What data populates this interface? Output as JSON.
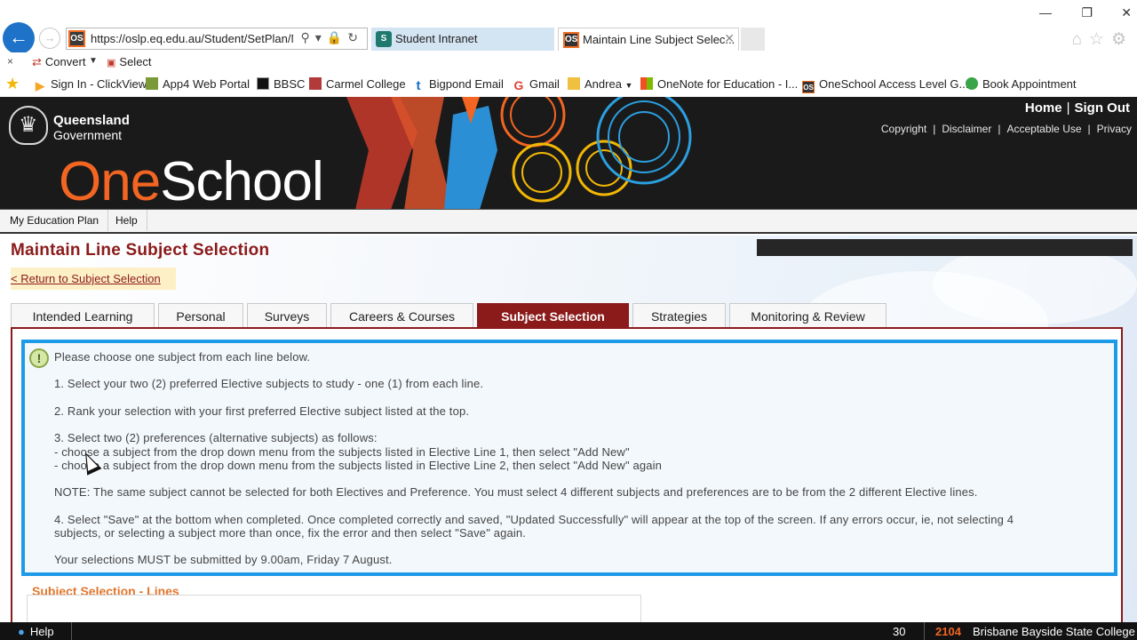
{
  "browser": {
    "address": "https://oslp.eq.edu.au/Student/SetPlan/M",
    "tabs": [
      {
        "label": "Student Intranet"
      },
      {
        "label": "Maintain Line Subject Selec..."
      }
    ],
    "favicon_text": "OS"
  },
  "command_bar": {
    "close": "×",
    "convert": "Convert",
    "select": "Select"
  },
  "favorites": [
    {
      "label": "Sign In - ClickView",
      "icon": "arrow-icon",
      "color": "#f5a623"
    },
    {
      "label": "App4 Web Portal",
      "icon": "app4-icon",
      "color": "#7a9a3a"
    },
    {
      "label": "BBSC",
      "icon": "bbsc-icon",
      "color": "#111111"
    },
    {
      "label": "Carmel College",
      "icon": "carmel-icon",
      "color": "#b33a3a"
    },
    {
      "label": "Bigpond Email",
      "icon": "bigpond-icon",
      "color": "#1a6fc9"
    },
    {
      "label": "Gmail",
      "icon": "google-icon",
      "color": "#db4437"
    },
    {
      "label": "Andrea",
      "icon": "folder-icon",
      "color": "#f0c040"
    },
    {
      "label": "OneNote for Education - I...",
      "icon": "microsoft-icon",
      "color": "#f25022"
    },
    {
      "label": "OneSchool Access Level G...",
      "icon": "oneschool-icon",
      "color": "#333333"
    },
    {
      "label": "Book Appointment",
      "icon": "gear-icon",
      "color": "#3aa548"
    }
  ],
  "header": {
    "gov_line1": "Queensland",
    "gov_line2": "Government",
    "brand_one": "One",
    "brand_school": "School",
    "home": "Home",
    "sign_out": "Sign Out",
    "links": [
      "Copyright",
      "Disclaimer",
      "Acceptable Use",
      "Privacy"
    ]
  },
  "menu": [
    "My Education Plan",
    "Help"
  ],
  "page": {
    "title": "Maintain Line Subject Selection",
    "return_link": "< Return to Subject Selection",
    "tabs": [
      {
        "label": "Intended Learning",
        "active": false
      },
      {
        "label": "Personal",
        "active": false
      },
      {
        "label": "Surveys",
        "active": false
      },
      {
        "label": "Careers & Courses",
        "active": false
      },
      {
        "label": "Subject Selection",
        "active": true
      },
      {
        "label": "Strategies",
        "active": false
      },
      {
        "label": "Monitoring & Review",
        "active": false
      }
    ],
    "note": {
      "icon": "!",
      "lines": [
        "Please choose one subject from each line below.",
        "1. Select your two (2) preferred Elective subjects to study - one (1) from each line.",
        "2. Rank your selection with your first preferred Elective subject listed at the top.",
        "3. Select two (2) preferences (alternative subjects) as follows:",
        "- choose a subject from the drop down menu from the subjects listed in Elective Line 1, then select \"Add New\"",
        "- choose a subject from the drop down menu from the subjects listed in Elective Line 2, then select \"Add New\" again",
        "NOTE: The same subject cannot be selected for both Electives and Preference. You must select 4 different subjects and preferences are to be from the 2 different Elective lines.",
        "4. Select \"Save\" at the bottom when completed. Once completed correctly and saved, \"Updated Successfully\" will appear at the top of the screen. If any errors occur, ie, not selecting 4",
        "subjects, or selecting a subject more than once, fix the error and then select \"Save\" again.",
        "Your selections MUST be submitted by 9.00am, Friday 7 August."
      ]
    },
    "section_title": "Subject Selection - Lines"
  },
  "status_bar": {
    "help": "Help",
    "count": "30",
    "school_code": "2104",
    "school_name": "Brisbane Bayside State College"
  }
}
